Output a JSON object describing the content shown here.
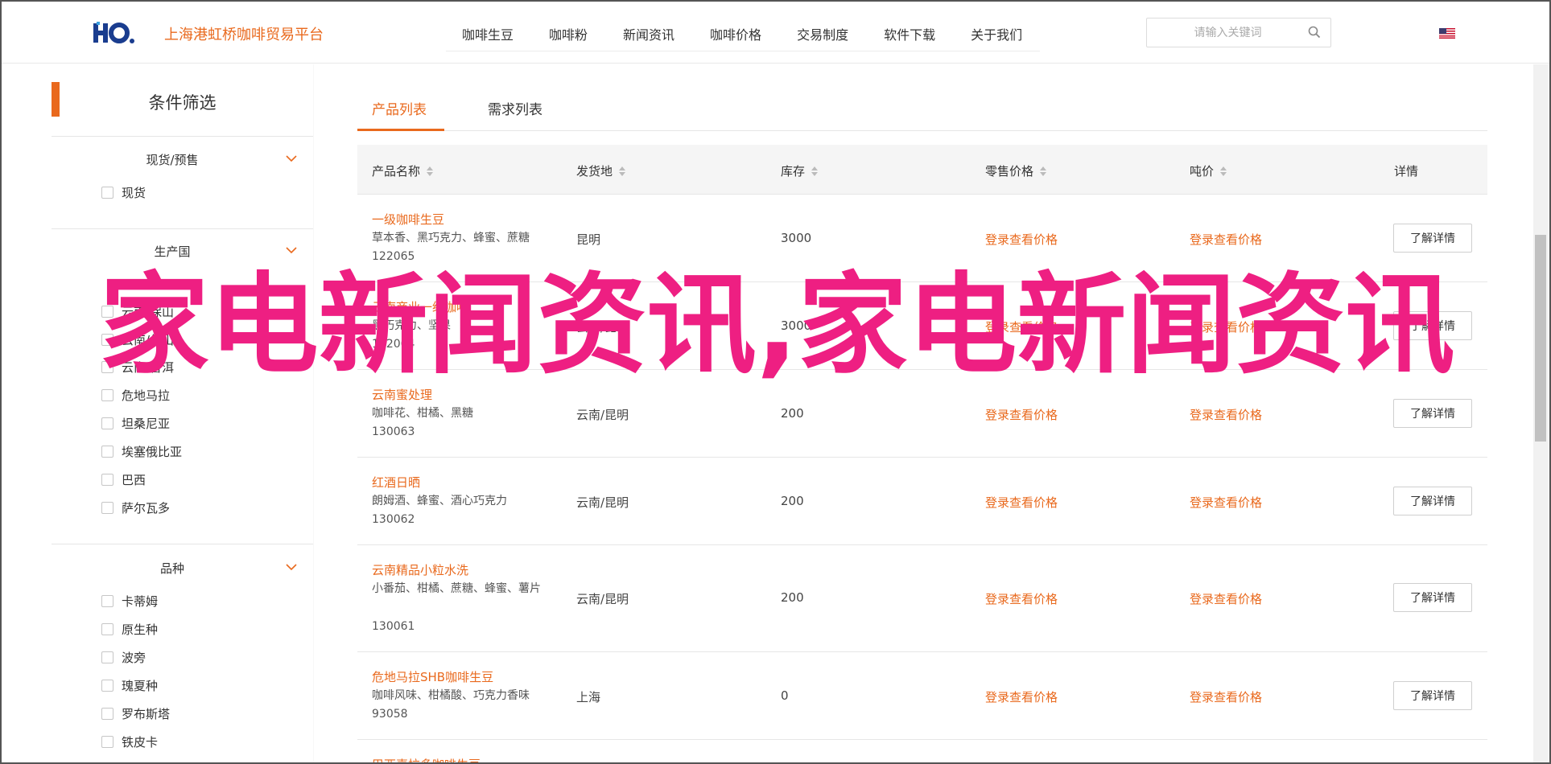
{
  "header": {
    "logo_text": "HO.",
    "site_title": "上海港虹桥咖啡贸易平台",
    "nav": [
      "咖啡生豆",
      "咖啡粉",
      "新闻资讯",
      "咖啡价格",
      "交易制度",
      "软件下载",
      "关于我们"
    ],
    "search_placeholder": "请输入关键词"
  },
  "sidebar": {
    "title": "条件筛选",
    "groups": [
      {
        "title": "现货/预售",
        "options": [
          "现货"
        ]
      },
      {
        "title": "生产国",
        "options": [
          "云南/保山",
          "云南/保山",
          "云南/普洱",
          "危地马拉",
          "坦桑尼亚",
          "埃塞俄比亚",
          "巴西",
          "萨尔瓦多"
        ]
      },
      {
        "title": "品种",
        "options": [
          "卡蒂姆",
          "原生种",
          "波旁",
          "瑰夏种",
          "罗布斯塔",
          "铁皮卡"
        ]
      }
    ]
  },
  "tabs": [
    "产品列表",
    "需求列表"
  ],
  "table": {
    "headers": [
      "产品名称",
      "发货地",
      "库存",
      "零售价格",
      "吨价",
      "详情"
    ],
    "price_text": "登录查看价格",
    "detail_label": "了解详情",
    "rows": [
      {
        "name": "一级咖啡生豆",
        "desc": "草本香、黑巧克力、蜂蜜、蔗糖",
        "id": "122065",
        "origin": "昆明",
        "stock": "3000"
      },
      {
        "name": "云南商业一级咖啡",
        "desc": "黑巧克力、坚果",
        "id": "122064",
        "origin": "云南/昆明",
        "stock": "3000"
      },
      {
        "name": "云南蜜处理",
        "desc": "咖啡花、柑橘、黑糖",
        "id": "130063",
        "origin": "云南/昆明",
        "stock": "200"
      },
      {
        "name": "红酒日晒",
        "desc": "朗姆酒、蜂蜜、酒心巧克力",
        "id": "130062",
        "origin": "云南/昆明",
        "stock": "200"
      },
      {
        "name": "云南精品小粒水洗",
        "desc": "小番茄、柑橘、蔗糖、蜂蜜、薯片",
        "id": "130061",
        "origin": "云南/昆明",
        "stock": "200"
      },
      {
        "name": "危地马拉SHB咖啡生豆",
        "desc": "咖啡风味、柑橘酸、巧克力香味",
        "id": "93058",
        "origin": "上海",
        "stock": "0"
      },
      {
        "name": "巴西喜拉多咖啡生豆",
        "desc": "",
        "id": "",
        "origin": "",
        "stock": ""
      }
    ]
  },
  "overlay_text": "家电新闻资讯,家电新闻资讯",
  "colors": {
    "accent": "#e9691d",
    "overlay": "#ee1f82",
    "logo": "#1a3d8f"
  }
}
